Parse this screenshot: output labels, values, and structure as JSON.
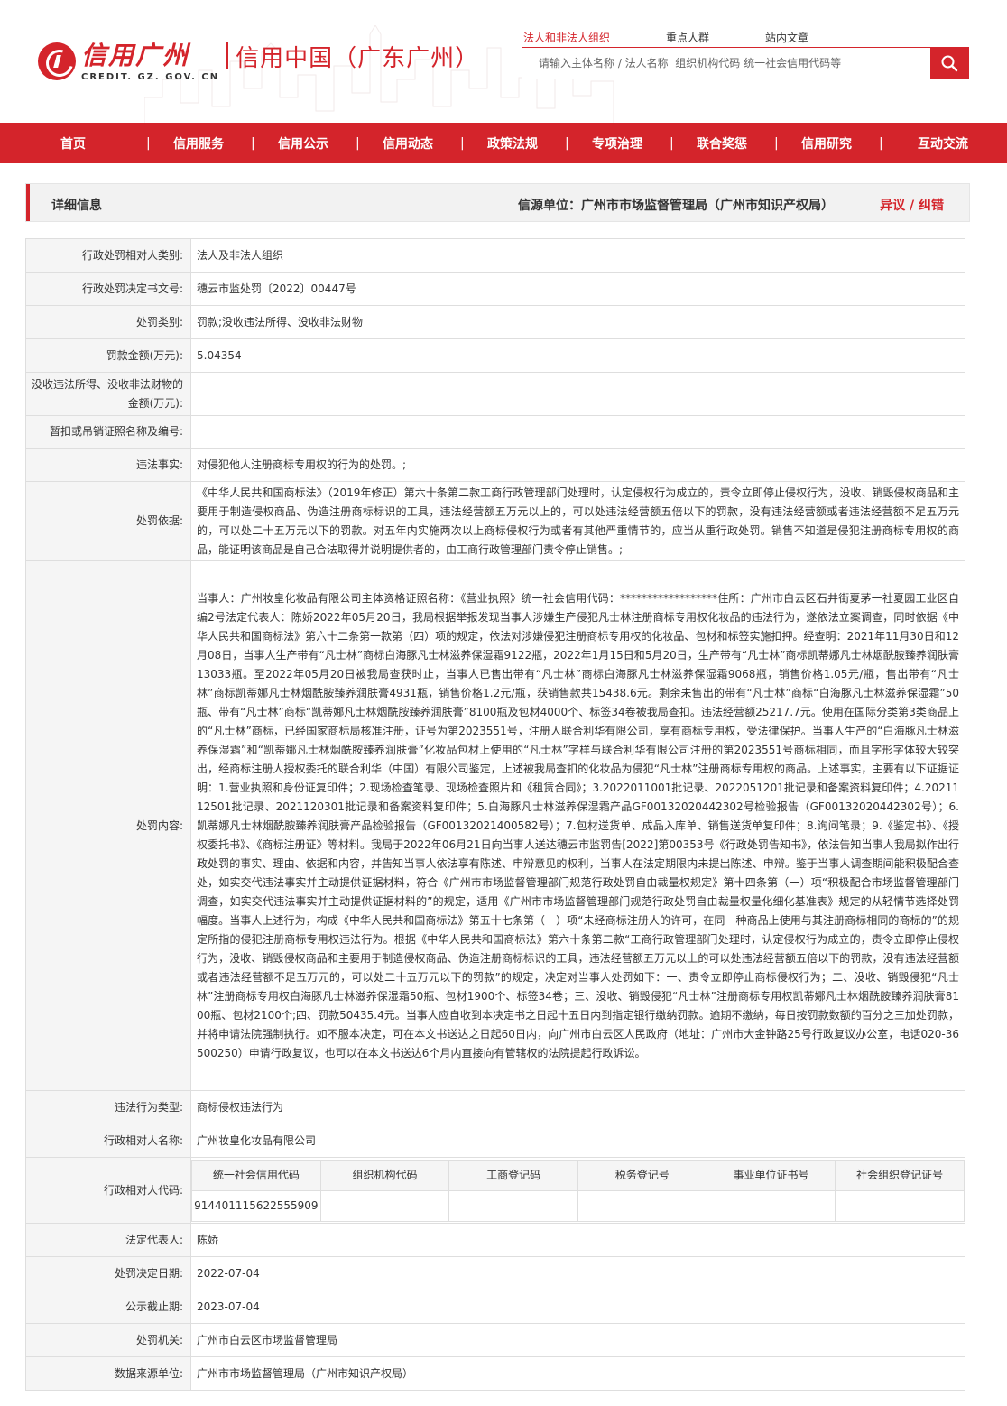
{
  "header": {
    "logo_cn": "信用广州",
    "logo_en": "CREDIT. GZ. GOV. CN",
    "logo_sub": "信用中国（广东广州）",
    "search_tabs": [
      "法人和非法人组织",
      "重点人群",
      "站内文章"
    ],
    "search_placeholder": "请输入主体名称 / 法人名称  组织机构代码 统一社会信用代码等",
    "accent_color": "#d4242b"
  },
  "nav": {
    "items": [
      "首页",
      "信用服务",
      "信用公示",
      "信用动态",
      "政策法规",
      "专项治理",
      "联合奖惩",
      "信用研究",
      "互动交流"
    ]
  },
  "detail_bar": {
    "title": "详细信息",
    "source": "信源单位：广州市市场监督管理局（广州市知识产权局）",
    "objection": "异议 / 纠错"
  },
  "rows": [
    {
      "label": "行政处罚相对人类别:",
      "value": "法人及非法人组织"
    },
    {
      "label": "行政处罚决定书文号:",
      "value": "穗云市监处罚〔2022〕00447号"
    },
    {
      "label": "处罚类别:",
      "value": "罚款;没收违法所得、没收非法财物"
    },
    {
      "label": "罚款金额(万元):",
      "value": "5.04354"
    },
    {
      "label": "没收违法所得、没收非法财物的金额(万元):",
      "value": ""
    },
    {
      "label": "暂扣或吊销证照名称及编号:",
      "value": ""
    },
    {
      "label": "违法事实:",
      "value": "对侵犯他人注册商标专用权的行为的处罚。;"
    },
    {
      "label": "处罚依据:",
      "value": "《中华人民共和国商标法》（2019年修正）第六十条第二款工商行政管理部门处理时，认定侵权行为成立的，责令立即停止侵权行为，没收、销毁侵权商品和主要用于制造侵权商品、伪造注册商标标识的工具，违法经营额五万元以上的，可以处违法经营额五倍以下的罚款，没有违法经营额或者违法经营额不足五万元的，可以处二十五万元以下的罚款。对五年内实施两次以上商标侵权行为或者有其他严重情节的，应当从重行政处罚。销售不知道是侵犯注册商标专用权的商品，能证明该商品是自己合法取得并说明提供者的，由工商行政管理部门责令停止销售。;"
    },
    {
      "label": "处罚内容:",
      "value": "当事人：广州妆皇化妆品有限公司主体资格证照名称：《营业执照》统一社会信用代码：******************住所：广州市白云区石井街夏茅一社夏园工业区自编2号法定代表人：陈娇2022年05月20日，我局根据举报发现当事人涉嫌生产侵犯凡士林注册商标专用权化妆品的违法行为，遂依法立案调查，同时依据《中华人民共和国商标法》第六十二条第一款第（四）项的规定，依法对涉嫌侵犯注册商标专用权的化妆品、包材和标签实施扣押。经查明：2021年11月30日和12月08日，当事人生产带有“凡士林”商标白海豚凡士林滋养保湿霜9122瓶，2022年1月15日和5月20日，生产带有“凡士林”商标凯蒂娜凡士林烟酰胺臻养润肤膏13033瓶。至2022年05月20日被我局查获时止，当事人已售出带有“凡士林”商标白海豚凡士林滋养保湿霜9068瓶，销售价格1.05元/瓶，售出带有“凡士林”商标凯蒂娜凡士林烟酰胺臻养润肤膏4931瓶，销售价格1.2元/瓶，获销售款共15438.6元。剩余未售出的带有“凡士林”商标“白海豚凡士林滋养保湿霜”50瓶、带有“凡士林”商标“凯蒂娜凡士林烟酰胺臻养润肤膏”8100瓶及包材4000个、标签34卷被我局查扣。违法经营额25217.7元。使用在国际分类第3类商品上的“凡士林”商标，已经国家商标局核准注册，证号为第2023551号，注册人联合利华有限公司，享有商标专用权，受法律保护。当事人生产的“白海豚凡士林滋养保湿霜”和“凯蒂娜凡士林烟酰胺臻养润肤膏”化妆品包材上使用的“凡士林”字样与联合利华有限公司注册的第2023551号商标相同，而且字形字体较大较突出，经商标注册人授权委托的联合利华（中国）有限公司鉴定，上述被我局查扣的化妆品为侵犯“凡士林”注册商标专用权的商品。上述事实，主要有以下证据证明：1.营业执照和身份证复印件；2.现场检查笔录、现场检查照片和《租赁合同》；3.2022011001批记录、2022051201批记录和备案资料复印件；4.2021112501批记录、2021120301批记录和备案资料复印件；5.白海豚凡士林滋养保湿霜产品GF00132020442302号检验报告（GF00132020442302号）；6.凯蒂娜凡士林烟酰胺臻养润肤膏产品检验报告（GF00132021400582号）；7.包材送货单、成品入库单、销售送货单复印件；8.询问笔录；9.《鉴定书》、《授权委托书》、《商标注册证》等材料。我局于2022年06月21日向当事人送达穗云市监罚告[2022]第00353号《行政处罚告知书》，依法告知当事人我局拟作出行政处罚的事实、理由、依据和内容，并告知当事人依法享有陈述、申辩意见的权利，当事人在法定期限内未提出陈述、申辩。鉴于当事人调查期间能积极配合查处，如实交代违法事实并主动提供证据材料，符合《广州市市场监督管理部门规范行政处罚自由裁量权规定》第十四条第（一）项“积极配合市场监督管理部门调查，如实交代违法事实并主动提供证据材料的”的规定，适用《广州市市场监督管理部门规范行政处罚自由裁量权量化细化基准表》规定的从轻情节选择处罚幅度。当事人上述行为，构成《中华人民共和国商标法》第五十七条第（一）项“未经商标注册人的许可，在同一种商品上使用与其注册商标相同的商标的”的规定所指的侵犯注册商标专用权违法行为。根据《中华人民共和国商标法》第六十条第二款“工商行政管理部门处理时，认定侵权行为成立的，责令立即停止侵权行为，没收、销毁侵权商品和主要用于制造侵权商品、伪造注册商标标识的工具，违法经营额五万元以上的可以处违法经营额五倍以下的罚款，没有违法经营额或者违法经营额不足五万元的，可以处二十五万元以下的罚款”的规定，决定对当事人处罚如下：一、责令立即停止商标侵权行为；二、没收、销毁侵犯“凡士林”注册商标专用权白海豚凡士林滋养保湿霜50瓶、包材1900个、标签34卷；三、没收、销毁侵犯“凡士林”注册商标专用权凯蒂娜凡士林烟酰胺臻养润肤膏8100瓶、包材2100个;四、罚款50435.4元。当事人应自收到本决定书之日起十五日内到指定银行缴纳罚款。逾期不缴纳，每日按罚款数额的百分之三加处罚款，并将申请法院强制执行。如不服本决定，可在本文书送达之日起60日内，向广州市白云区人民政府（地址：广州市大金钟路25号行政复议办公室，电话020-36500250）申请行政复议，也可以在本文书送达6个月内直接向有管辖权的法院提起行政诉讼。"
    },
    {
      "label": "违法行为类型:",
      "value": "商标侵权违法行为"
    },
    {
      "label": "行政相对人名称:",
      "value": "广州妆皇化妆品有限公司"
    }
  ],
  "code_row": {
    "label": "行政相对人代码:",
    "headers": [
      "统一社会信用代码",
      "组织机构代码",
      "工商登记码",
      "税务登记号",
      "事业单位证书号",
      "社会组织登记证号"
    ],
    "values": [
      "914401115622555909",
      "",
      "",
      "",
      "",
      ""
    ]
  },
  "rows_after": [
    {
      "label": "法定代表人:",
      "value": "陈娇"
    },
    {
      "label": "处罚决定日期:",
      "value": "2022-07-04"
    },
    {
      "label": "公示截止期:",
      "value": "2023-07-04"
    },
    {
      "label": "处罚机关:",
      "value": "广州市白云区市场监督管理局"
    },
    {
      "label": "数据来源单位:",
      "value": "广州市市场监督管理局（广州市知识产权局）"
    }
  ]
}
